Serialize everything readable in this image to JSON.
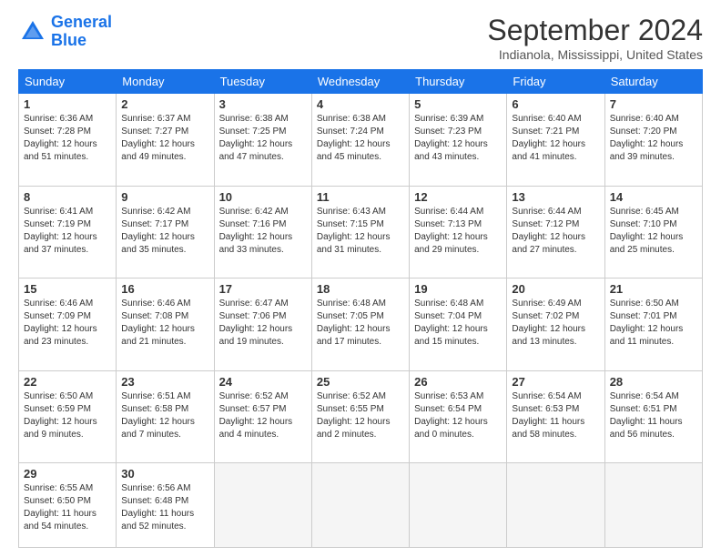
{
  "logo": {
    "text_general": "General",
    "text_blue": "Blue"
  },
  "header": {
    "month_title": "September 2024",
    "location": "Indianola, Mississippi, United States"
  },
  "days_of_week": [
    "Sunday",
    "Monday",
    "Tuesday",
    "Wednesday",
    "Thursday",
    "Friday",
    "Saturday"
  ],
  "weeks": [
    [
      {
        "day": "1",
        "info": "Sunrise: 6:36 AM\nSunset: 7:28 PM\nDaylight: 12 hours\nand 51 minutes."
      },
      {
        "day": "2",
        "info": "Sunrise: 6:37 AM\nSunset: 7:27 PM\nDaylight: 12 hours\nand 49 minutes."
      },
      {
        "day": "3",
        "info": "Sunrise: 6:38 AM\nSunset: 7:25 PM\nDaylight: 12 hours\nand 47 minutes."
      },
      {
        "day": "4",
        "info": "Sunrise: 6:38 AM\nSunset: 7:24 PM\nDaylight: 12 hours\nand 45 minutes."
      },
      {
        "day": "5",
        "info": "Sunrise: 6:39 AM\nSunset: 7:23 PM\nDaylight: 12 hours\nand 43 minutes."
      },
      {
        "day": "6",
        "info": "Sunrise: 6:40 AM\nSunset: 7:21 PM\nDaylight: 12 hours\nand 41 minutes."
      },
      {
        "day": "7",
        "info": "Sunrise: 6:40 AM\nSunset: 7:20 PM\nDaylight: 12 hours\nand 39 minutes."
      }
    ],
    [
      {
        "day": "8",
        "info": "Sunrise: 6:41 AM\nSunset: 7:19 PM\nDaylight: 12 hours\nand 37 minutes."
      },
      {
        "day": "9",
        "info": "Sunrise: 6:42 AM\nSunset: 7:17 PM\nDaylight: 12 hours\nand 35 minutes."
      },
      {
        "day": "10",
        "info": "Sunrise: 6:42 AM\nSunset: 7:16 PM\nDaylight: 12 hours\nand 33 minutes."
      },
      {
        "day": "11",
        "info": "Sunrise: 6:43 AM\nSunset: 7:15 PM\nDaylight: 12 hours\nand 31 minutes."
      },
      {
        "day": "12",
        "info": "Sunrise: 6:44 AM\nSunset: 7:13 PM\nDaylight: 12 hours\nand 29 minutes."
      },
      {
        "day": "13",
        "info": "Sunrise: 6:44 AM\nSunset: 7:12 PM\nDaylight: 12 hours\nand 27 minutes."
      },
      {
        "day": "14",
        "info": "Sunrise: 6:45 AM\nSunset: 7:10 PM\nDaylight: 12 hours\nand 25 minutes."
      }
    ],
    [
      {
        "day": "15",
        "info": "Sunrise: 6:46 AM\nSunset: 7:09 PM\nDaylight: 12 hours\nand 23 minutes."
      },
      {
        "day": "16",
        "info": "Sunrise: 6:46 AM\nSunset: 7:08 PM\nDaylight: 12 hours\nand 21 minutes."
      },
      {
        "day": "17",
        "info": "Sunrise: 6:47 AM\nSunset: 7:06 PM\nDaylight: 12 hours\nand 19 minutes."
      },
      {
        "day": "18",
        "info": "Sunrise: 6:48 AM\nSunset: 7:05 PM\nDaylight: 12 hours\nand 17 minutes."
      },
      {
        "day": "19",
        "info": "Sunrise: 6:48 AM\nSunset: 7:04 PM\nDaylight: 12 hours\nand 15 minutes."
      },
      {
        "day": "20",
        "info": "Sunrise: 6:49 AM\nSunset: 7:02 PM\nDaylight: 12 hours\nand 13 minutes."
      },
      {
        "day": "21",
        "info": "Sunrise: 6:50 AM\nSunset: 7:01 PM\nDaylight: 12 hours\nand 11 minutes."
      }
    ],
    [
      {
        "day": "22",
        "info": "Sunrise: 6:50 AM\nSunset: 6:59 PM\nDaylight: 12 hours\nand 9 minutes."
      },
      {
        "day": "23",
        "info": "Sunrise: 6:51 AM\nSunset: 6:58 PM\nDaylight: 12 hours\nand 7 minutes."
      },
      {
        "day": "24",
        "info": "Sunrise: 6:52 AM\nSunset: 6:57 PM\nDaylight: 12 hours\nand 4 minutes."
      },
      {
        "day": "25",
        "info": "Sunrise: 6:52 AM\nSunset: 6:55 PM\nDaylight: 12 hours\nand 2 minutes."
      },
      {
        "day": "26",
        "info": "Sunrise: 6:53 AM\nSunset: 6:54 PM\nDaylight: 12 hours\nand 0 minutes."
      },
      {
        "day": "27",
        "info": "Sunrise: 6:54 AM\nSunset: 6:53 PM\nDaylight: 11 hours\nand 58 minutes."
      },
      {
        "day": "28",
        "info": "Sunrise: 6:54 AM\nSunset: 6:51 PM\nDaylight: 11 hours\nand 56 minutes."
      }
    ],
    [
      {
        "day": "29",
        "info": "Sunrise: 6:55 AM\nSunset: 6:50 PM\nDaylight: 11 hours\nand 54 minutes."
      },
      {
        "day": "30",
        "info": "Sunrise: 6:56 AM\nSunset: 6:48 PM\nDaylight: 11 hours\nand 52 minutes."
      },
      {
        "day": "",
        "info": ""
      },
      {
        "day": "",
        "info": ""
      },
      {
        "day": "",
        "info": ""
      },
      {
        "day": "",
        "info": ""
      },
      {
        "day": "",
        "info": ""
      }
    ]
  ]
}
